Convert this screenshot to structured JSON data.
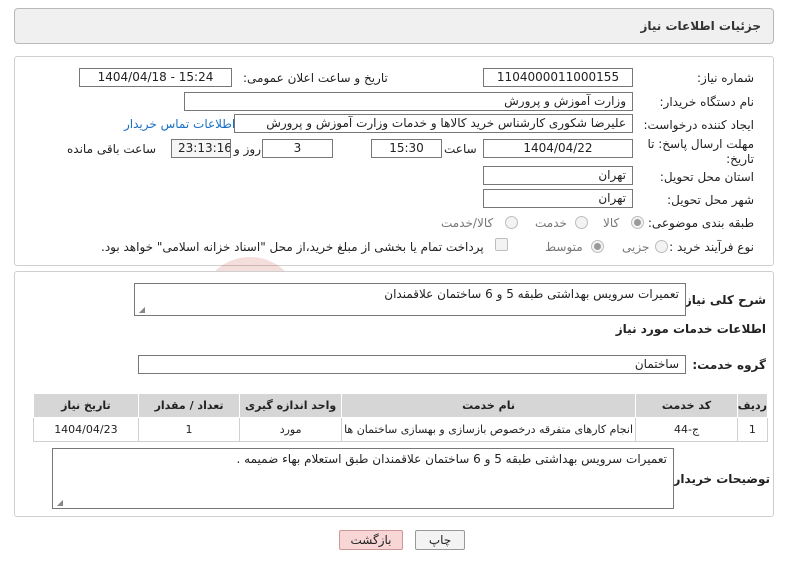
{
  "header": {
    "title": "جزئیات اطلاعات نیاز"
  },
  "form": {
    "need_number_label": "شماره نیاز:",
    "need_number": "1104000011000155",
    "announce_label": "تاریخ و ساعت اعلان عمومی:",
    "announce_value": "1404/04/18 - 15:24",
    "buyer_org_label": "نام دستگاه خریدار:",
    "buyer_org": "وزارت آموزش و پرورش",
    "creator_label": "ایجاد کننده درخواست:",
    "creator": "علیرضا شکوری کارشناس خرید کالاها و خدمات وزارت آموزش و پرورش",
    "contact_link": "اطلاعات تماس خریدار",
    "deadline_label_1": "مهلت ارسال پاسخ: تا",
    "deadline_label_2": "تاریخ:",
    "deadline_date": "1404/04/22",
    "time_label": "ساعت",
    "deadline_time": "15:30",
    "days_value": "3",
    "days_label": "روز و",
    "remaining_time": "23:13:16",
    "remaining_label": "ساعت باقی مانده",
    "province_label": "استان محل تحویل:",
    "province": "تهران",
    "city_label": "شهر محل تحویل:",
    "city": "تهران",
    "category_label": "طبقه بندی موضوعی:",
    "category_options": [
      "کالا",
      "خدمت",
      "کالا/خدمت"
    ],
    "process_label": "نوع فرآیند خرید :",
    "process_options": [
      "جزیی",
      "متوسط"
    ],
    "payment_note": "پرداخت تمام یا بخشی از مبلغ خرید،از محل \"اسناد خزانه اسلامی\" خواهد بود."
  },
  "details": {
    "summary_label": "شرح کلی نیاز:",
    "summary": "تعمیرات سرویس بهداشتی طبقه 5 و 6 ساختمان علاقمندان",
    "services_title": "اطلاعات خدمات مورد نیاز",
    "service_group_label": "گروه خدمت:",
    "service_group": "ساختمان",
    "table": {
      "headers": [
        "ردیف",
        "کد خدمت",
        "نام خدمت",
        "واحد اندازه گیری",
        "تعداد / مقدار",
        "تاریخ نیاز"
      ],
      "rows": [
        [
          "1",
          "ج-44",
          "انجام کارهای متفرقه درخصوص بازسازی و بهسازی ساختمان ها",
          "مورد",
          "1",
          "1404/04/23"
        ]
      ]
    },
    "buyer_notes_label": "توضیحات خریدار:",
    "buyer_notes": "تعمیرات سرویس بهداشتی طبقه 5 و 6 ساختمان علاقمندان طبق استعلام بهاء ضمیمه ."
  },
  "buttons": {
    "print": "چاپ",
    "back": "بازگشت"
  },
  "watermark": {
    "text": "AriaTender.neT"
  },
  "colors": {
    "link": "#1a6fc4",
    "back_button": "#f9d6d6",
    "table_header": "#d6d6d6"
  }
}
